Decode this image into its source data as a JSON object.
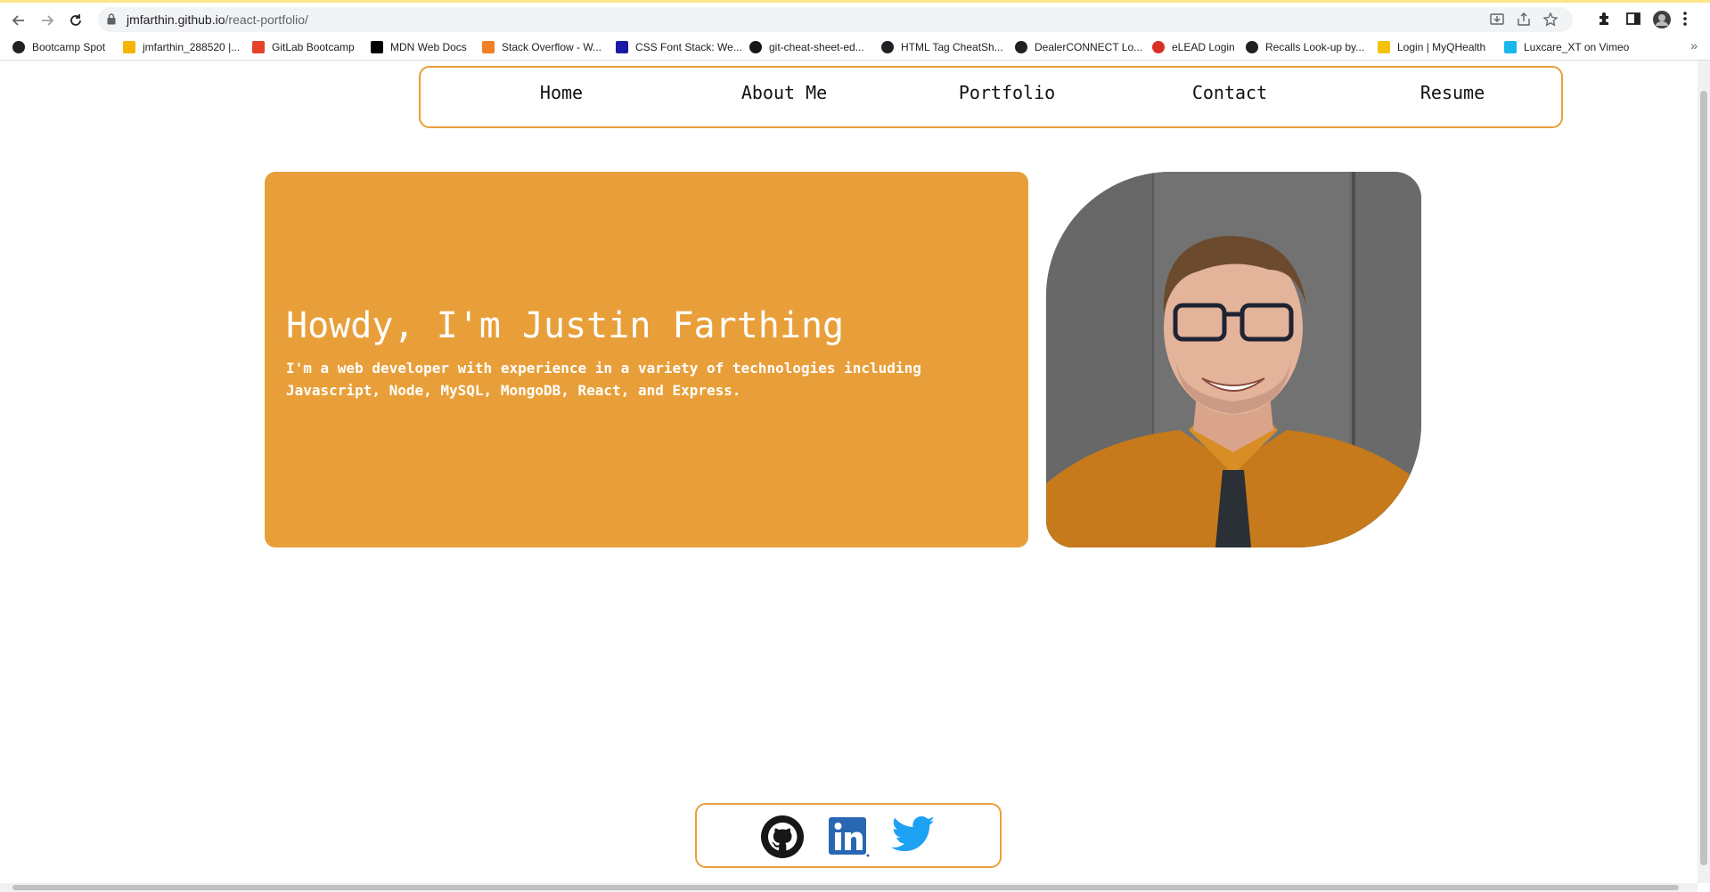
{
  "browser": {
    "url_host": "jmfarthin.github.io",
    "url_path": "/react-portfolio/",
    "bookmarks": [
      {
        "label": "Bootcamp Spot",
        "icon": "globe-icon",
        "color": "#202124"
      },
      {
        "label": "jmfarthin_288520 |...",
        "icon": "bee-icon",
        "color": "#f4b400"
      },
      {
        "label": "GitLab Bootcamp",
        "icon": "gitlab-icon",
        "color": "#e24329"
      },
      {
        "label": "MDN Web Docs",
        "icon": "mdn-icon",
        "color": "#000000"
      },
      {
        "label": "Stack Overflow - W...",
        "icon": "stackoverflow-icon",
        "color": "#f48024"
      },
      {
        "label": "CSS Font Stack: We...",
        "icon": "cssfontstack-icon",
        "color": "#1a1aa6"
      },
      {
        "label": "git-cheat-sheet-ed...",
        "icon": "github-icon",
        "color": "#181717"
      },
      {
        "label": "HTML Tag CheatSh...",
        "icon": "globe-icon",
        "color": "#202124"
      },
      {
        "label": "DealerCONNECT Lo...",
        "icon": "globe-icon",
        "color": "#202124"
      },
      {
        "label": "eLEAD Login",
        "icon": "elead-icon",
        "color": "#d93025"
      },
      {
        "label": "Recalls Look-up by...",
        "icon": "globe-icon",
        "color": "#202124"
      },
      {
        "label": "Login | MyQHealth",
        "icon": "myq-icon",
        "color": "#f4c20d"
      },
      {
        "label": "Luxcare_XT on Vimeo",
        "icon": "vimeo-icon",
        "color": "#1ab7ea"
      }
    ]
  },
  "nav": {
    "items": [
      "Home",
      "About Me",
      "Portfolio",
      "Contact",
      "Resume"
    ]
  },
  "hero": {
    "title": "Howdy, I'm Justin Farthing",
    "subtitle": "I'm a web developer with experience in a variety of technologies including Javascript, Node, MySQL, MongoDB, React, and Express."
  },
  "social": {
    "icons": [
      "github-icon",
      "linkedin-icon",
      "twitter-icon"
    ]
  },
  "colors": {
    "accent": "#e89f3a",
    "linkedin": "#2867b2",
    "twitter": "#1da1f2"
  }
}
